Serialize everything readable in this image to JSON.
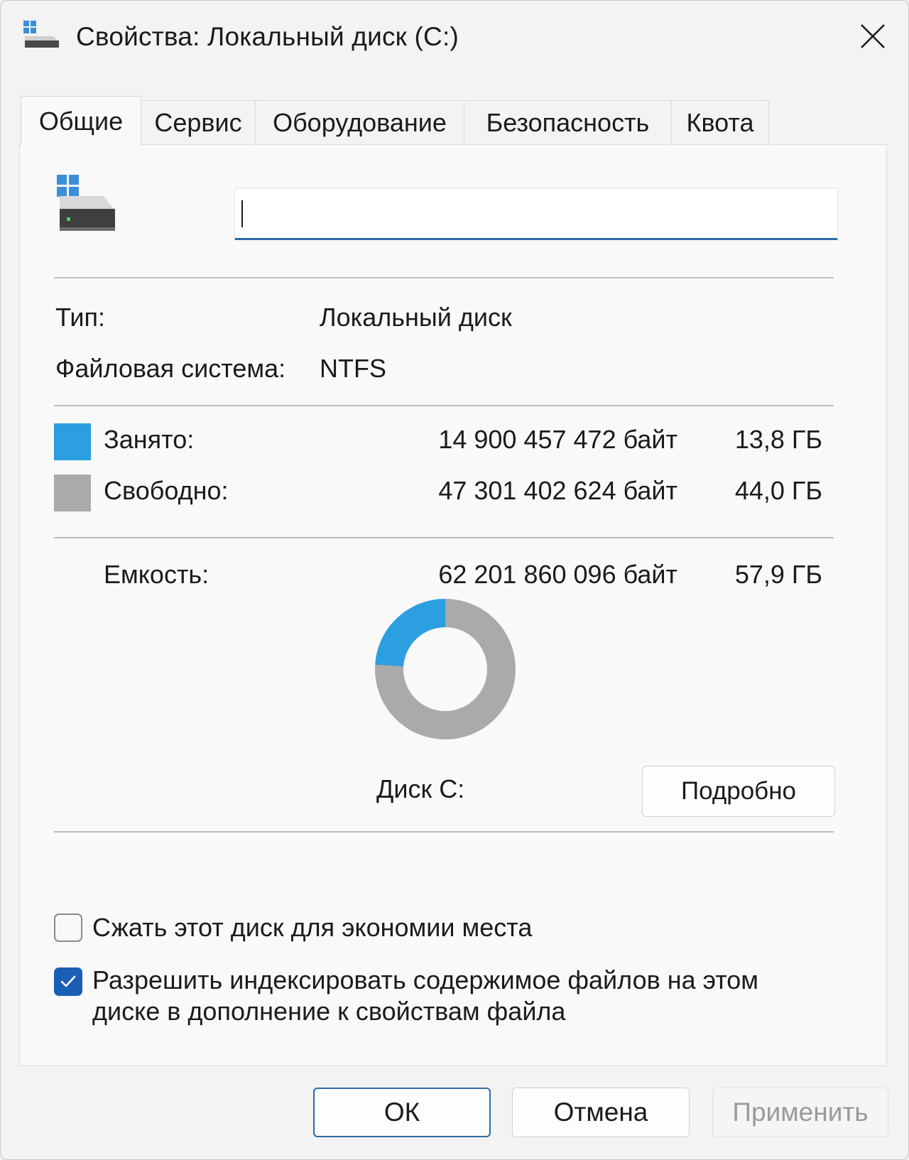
{
  "window": {
    "title": "Свойства: Локальный диск (C:)"
  },
  "tabs": [
    {
      "label": "Общие",
      "active": true
    },
    {
      "label": "Сервис",
      "active": false
    },
    {
      "label": "Оборудование",
      "active": false
    },
    {
      "label": "Безопасность",
      "active": false
    },
    {
      "label": "Квота",
      "active": false
    }
  ],
  "general": {
    "volume_label_value": "",
    "type_label": "Тип:",
    "type_value": "Локальный диск",
    "fs_label": "Файловая система:",
    "fs_value": "NTFS",
    "used_label": "Занято:",
    "used_bytes": "14 900 457 472 байт",
    "used_size": "13,8 ГБ",
    "free_label": "Свободно:",
    "free_bytes": "47 301 402 624 байт",
    "free_size": "44,0 ГБ",
    "capacity_label": "Емкость:",
    "capacity_bytes": "62 201 860 096 байт",
    "capacity_size": "57,9 ГБ",
    "drive_caption": "Диск C:",
    "details_button": "Подробно",
    "used_fraction": 0.2395,
    "colors": {
      "used": "#2b9fe0",
      "free": "#aaaaaa"
    }
  },
  "options": {
    "compress_label": "Сжать этот диск для экономии места",
    "compress_checked": false,
    "index_label": "Разрешить индексировать содержимое файлов на этом диске в дополнение к свойствам файла",
    "index_checked": true
  },
  "buttons": {
    "ok": "ОК",
    "cancel": "Отмена",
    "apply": "Применить",
    "apply_enabled": false
  }
}
